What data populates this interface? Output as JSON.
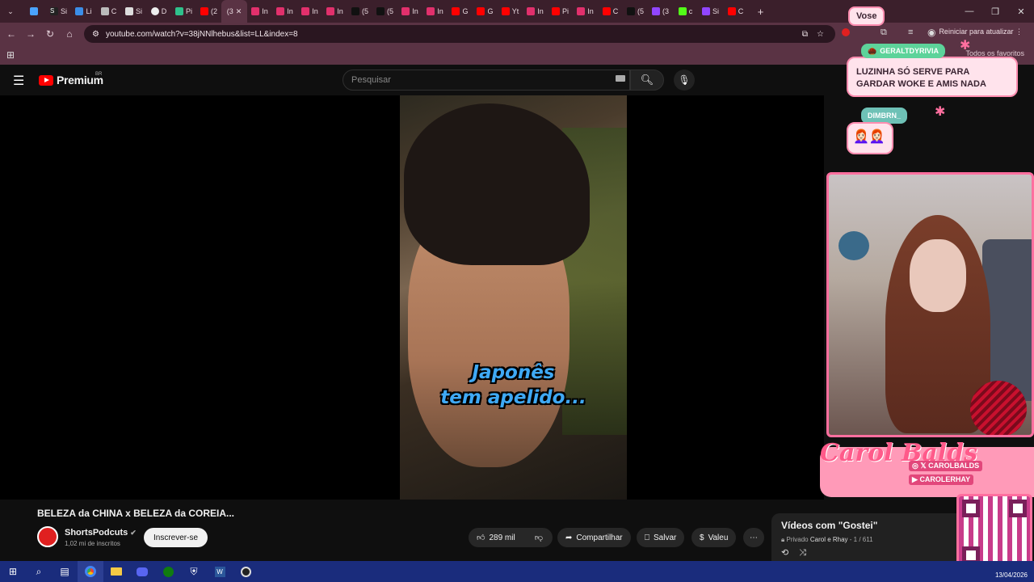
{
  "browser": {
    "tabs": [
      "",
      "Si",
      "Li",
      "C",
      "Si",
      "D",
      "Pi",
      "(2",
      "(3",
      "In",
      "In",
      "In",
      "In",
      "(5",
      "(5",
      "In",
      "In",
      "G",
      "G",
      "Yt",
      "In",
      "Pi",
      "In",
      "C",
      "(5",
      "(3",
      "c",
      "Si",
      "C"
    ],
    "url": "youtube.com/watch?v=38jNNlhebus&list=LL&index=8",
    "reset_label": "Reiniciar para atualizar",
    "bookmarks_label": "Todos os favoritos"
  },
  "youtube": {
    "logo_text": "Premium",
    "logo_region": "BR",
    "search_placeholder": "Pesquisar",
    "video": {
      "caption_line1": "Japonês",
      "caption_line2": "tem apelido..."
    },
    "title": "BELEZA da CHINA x BELEZA da COREIA...",
    "channel_name": "ShortsPodcuts",
    "subscribers": "1,02 mi de inscritos",
    "subscribe_label": "Inscrever-se",
    "likes": "289 mil",
    "share_label": "Compartilhar",
    "save_label": "Salvar",
    "thanks_label": "Valeu",
    "playlist": {
      "title": "Vídeos com \"Gostei\"",
      "privacy": "Privado",
      "owner": "Carol e Rhay",
      "position": "1 / 611"
    }
  },
  "overlay": {
    "top_tag": "Vose",
    "chat1_user": "GERALTDYRIVIA",
    "chat1_text": "LUZINHA SÓ SERVE PARA GARDAR WOKE E AMIS NADA",
    "chat2_user": "DIMBRN_",
    "chat2_emoji": "👩🏻‍🦰👩🏻‍🦰",
    "brand_name": "Carol Balds",
    "handle1": "CAROLBALDS",
    "handle2": "CAROLERHAY"
  },
  "taskbar": {
    "date": "13/04/2026"
  }
}
